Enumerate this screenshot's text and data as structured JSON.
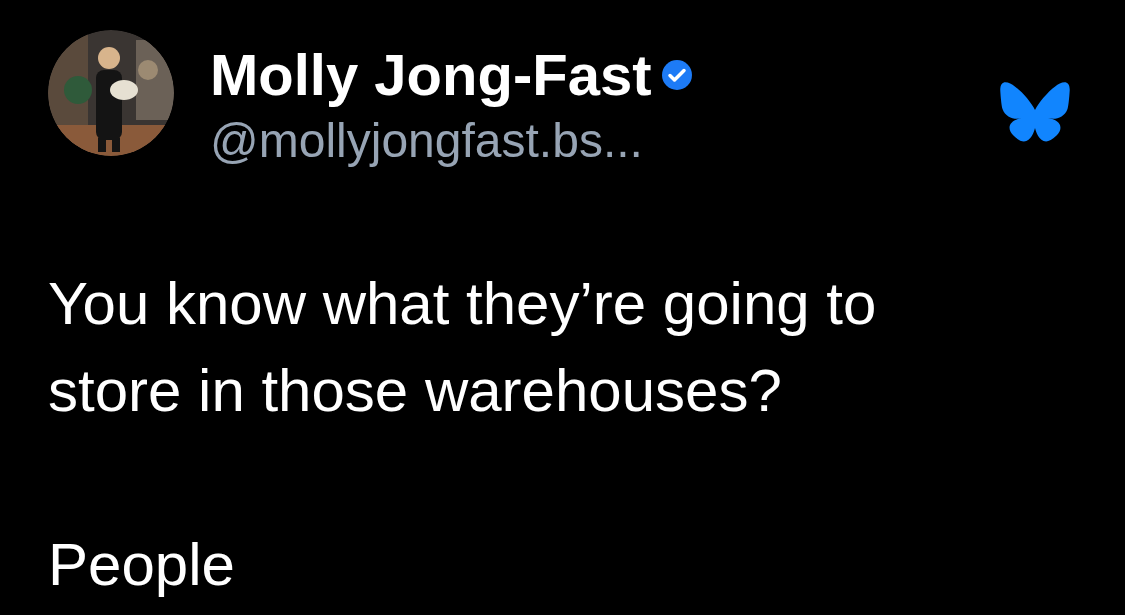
{
  "author": {
    "name": "Molly Jong-Fast",
    "verified": true,
    "handle": "@mollyjongfast.bs..."
  },
  "post": {
    "text": "You know what they’re going to\nstore in those warehouses?\n\nPeople"
  }
}
